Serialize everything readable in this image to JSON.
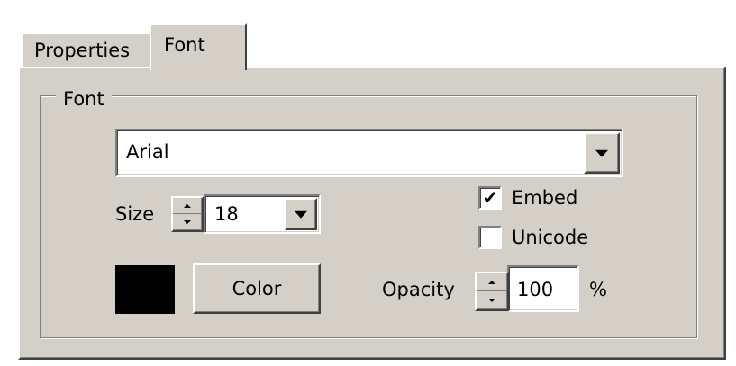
{
  "tabs": [
    {
      "label": "Properties",
      "active": false
    },
    {
      "label": "Font",
      "active": true
    }
  ],
  "group": {
    "label": "Font"
  },
  "font": {
    "selected": "Arial"
  },
  "size": {
    "label": "Size",
    "value": "18"
  },
  "embed": {
    "label": "Embed",
    "checked": true,
    "mark": "✔"
  },
  "unicode": {
    "label": "Unicode",
    "checked": false,
    "mark": ""
  },
  "color": {
    "button_label": "Color",
    "swatch": "#000000"
  },
  "opacity": {
    "label": "Opacity",
    "value": "100",
    "unit": "%"
  },
  "theme": {
    "face": "#d4d0c8",
    "highlight": "#ffffff",
    "shadow": "#808080",
    "dark_shadow": "#404040"
  }
}
